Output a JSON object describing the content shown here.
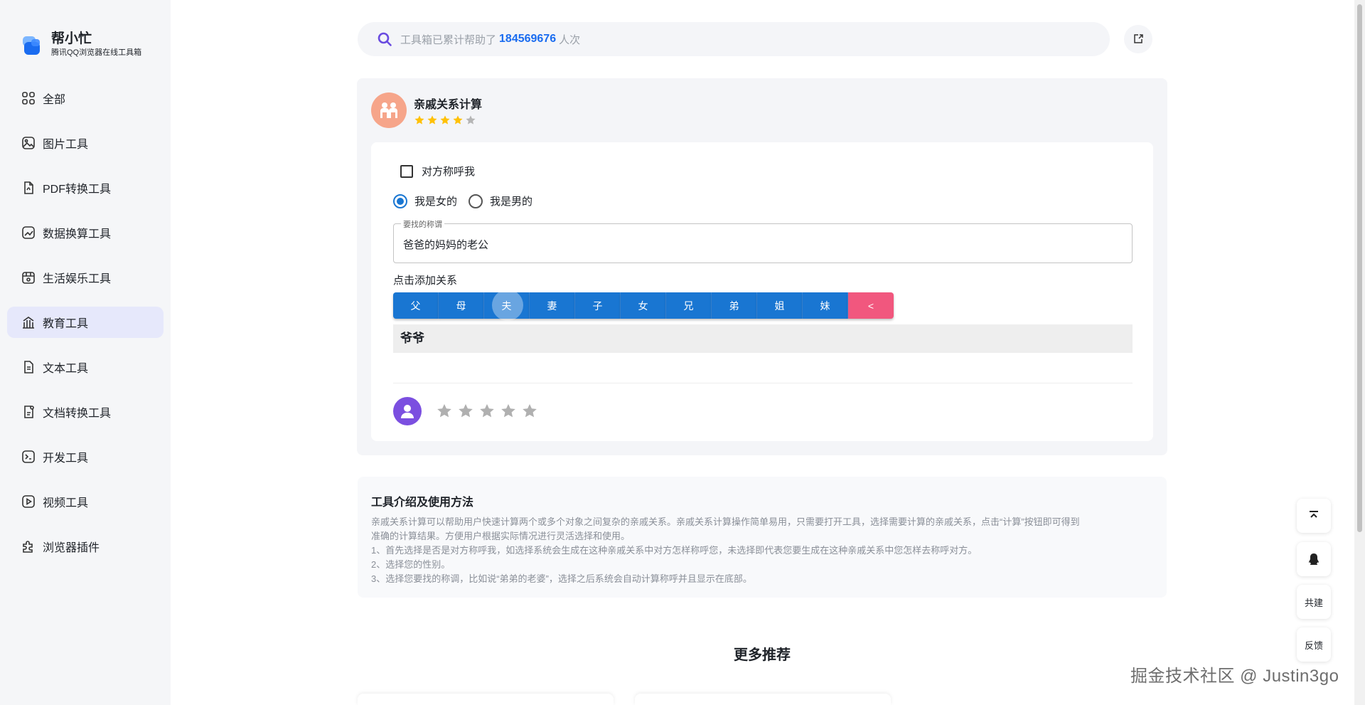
{
  "brand": {
    "name": "帮小忙",
    "subtitle": "腾讯QQ浏览器在线工具箱"
  },
  "sidebar": {
    "items": [
      {
        "label": "全部",
        "icon": "grid-icon"
      },
      {
        "label": "图片工具",
        "icon": "image-icon"
      },
      {
        "label": "PDF转换工具",
        "icon": "pdf-icon"
      },
      {
        "label": "数据换算工具",
        "icon": "chart-icon"
      },
      {
        "label": "生活娱乐工具",
        "icon": "store-icon"
      },
      {
        "label": "教育工具",
        "icon": "education-icon",
        "active": true
      },
      {
        "label": "文本工具",
        "icon": "text-icon"
      },
      {
        "label": "文档转换工具",
        "icon": "document-icon"
      },
      {
        "label": "开发工具",
        "icon": "terminal-icon"
      },
      {
        "label": "视频工具",
        "icon": "video-icon"
      },
      {
        "label": "浏览器插件",
        "icon": "puzzle-icon"
      }
    ]
  },
  "search": {
    "prefix": "工具箱已累计帮助了",
    "count": "184569676",
    "suffix": "人次"
  },
  "tool": {
    "title": "亲戚关系计算",
    "rating": 4,
    "checkbox_label": "对方称呼我",
    "checkbox_checked": false,
    "gender_options": [
      "我是女的",
      "我是男的"
    ],
    "gender_selected": 0,
    "field_legend": "要找的称谓",
    "field_value": "爸爸的妈妈的老公",
    "add_label": "点击添加关系",
    "keys": [
      "父",
      "母",
      "夫",
      "妻",
      "子",
      "女",
      "兄",
      "弟",
      "姐",
      "妹"
    ],
    "back_key": "<",
    "result": "爷爷"
  },
  "intro": {
    "title": "工具介绍及使用方法",
    "lines": [
      "亲戚关系计算可以帮助用户快速计算两个或多个对象之间复杂的亲戚关系。亲戚关系计算操作简单易用，只需要打开工具，选择需要计算的亲戚关系，点击“计算”按钮即可得到",
      "准确的计算结果。方便用户根据实际情况进行灵活选择和使用。",
      "1、首先选择是否是对方称呼我，如选择系统会生成在这种亲戚关系中对方怎样称呼您，未选择即代表您要生成在这种亲戚关系中您怎样去称呼对方。",
      "2、选择您的性别。",
      "3、选择您要找的称调，比如说“弟弟的老婆”，选择之后系统会自动计算称呼并且显示在底部。"
    ]
  },
  "more_title": "更多推荐",
  "float": {
    "collab": "共建",
    "feedback": "反馈"
  },
  "watermark": "掘金技术社区 @ Justin3go",
  "colors": {
    "primary": "#1976d2",
    "back_key": "#f1577e",
    "star": "#ffc107",
    "accent": "#1a6cf0"
  }
}
